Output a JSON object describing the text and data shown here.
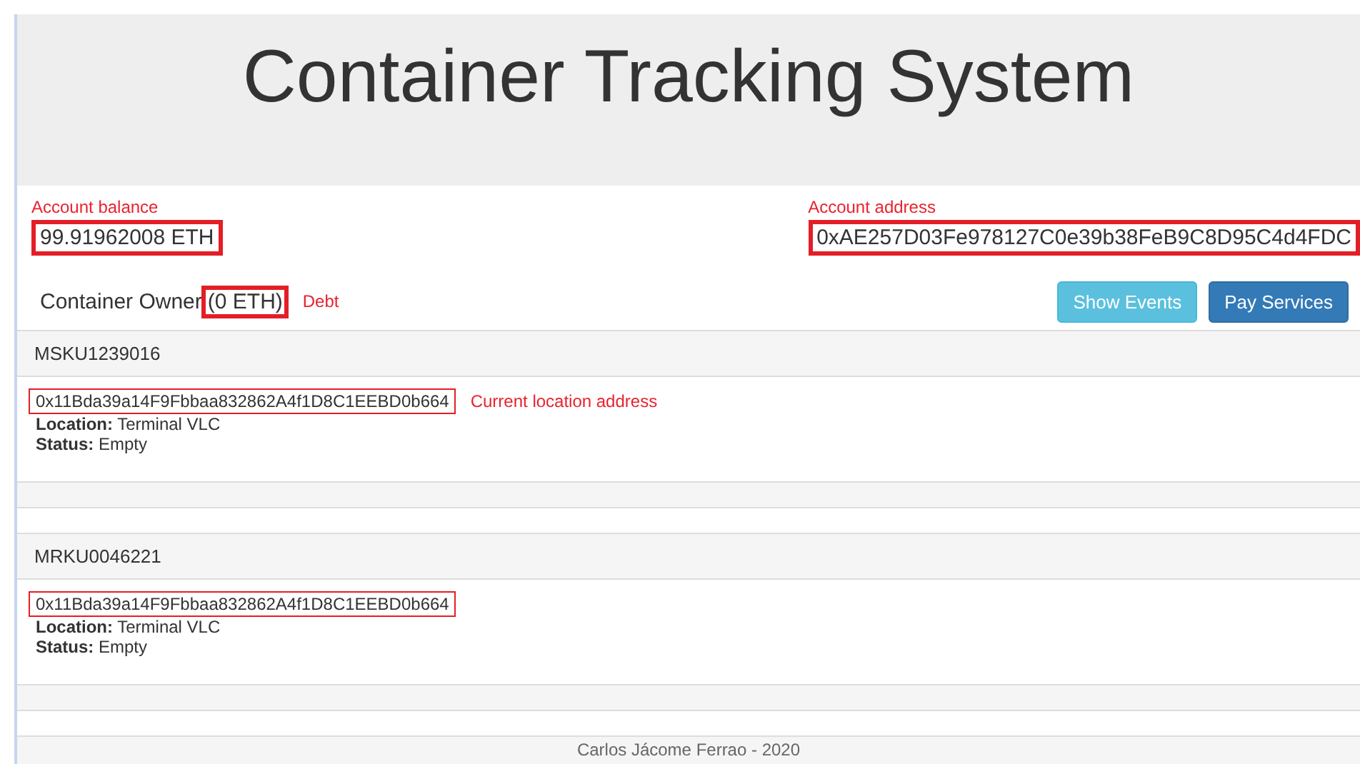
{
  "header": {
    "title": "Container Tracking System"
  },
  "account": {
    "balance_label": "Account balance",
    "balance": "99.91962008 ETH",
    "address_label": "Account address",
    "address": "0xAE257D03Fe978127C0e39b38FeB9C8D95C4d4FDC"
  },
  "owner": {
    "role": "Container Owner",
    "debt": "(0 ETH)",
    "debt_note": "Debt"
  },
  "buttons": [
    {
      "label": "Show Events",
      "kind": "info"
    },
    {
      "label": "Pay Services",
      "kind": "primary"
    }
  ],
  "containers": [
    {
      "code": "MSKU1239016",
      "address": "0x11Bda39a14F9Fbbaa832862A4f1D8C1EEBD0b664",
      "address_note": "Current location address",
      "location_label": "Location:",
      "location": "Terminal VLC",
      "status_label": "Status:",
      "status": "Empty"
    },
    {
      "code": "MRKU0046221",
      "address": "0x11Bda39a14F9Fbbaa832862A4f1D8C1EEBD0b664",
      "location_label": "Location:",
      "location": "Terminal VLC",
      "status_label": "Status:",
      "status": "Empty"
    }
  ],
  "footer": {
    "text": "Carlos Jácome Ferrao - 2020"
  }
}
